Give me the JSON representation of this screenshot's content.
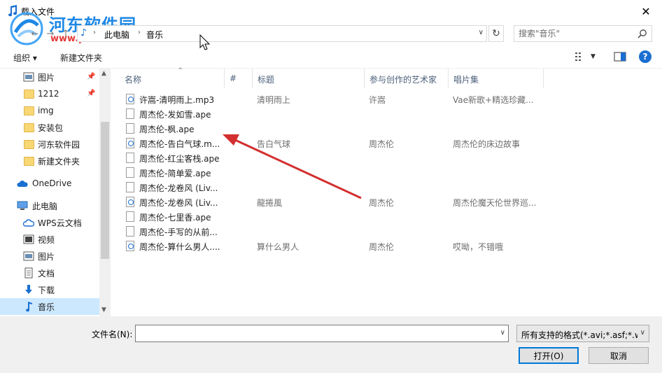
{
  "window": {
    "title": "载入文件",
    "close_glyph": "✕"
  },
  "watermark": {
    "name": "河东软件园",
    "url": "www.pc0359.cn"
  },
  "address": {
    "path": [
      "此电脑",
      "音乐"
    ]
  },
  "search": {
    "placeholder": "搜索\"音乐\""
  },
  "toolbar": {
    "organize_label": "组织 ▾",
    "new_folder_label": "新建文件夹"
  },
  "sidebar": {
    "items": [
      {
        "label": "图片",
        "icon": "pictures-icon",
        "pinned": true
      },
      {
        "label": "1212",
        "icon": "folder-icon",
        "pinned": true
      },
      {
        "label": "img",
        "icon": "folder-icon"
      },
      {
        "label": "安装包",
        "icon": "folder-icon"
      },
      {
        "label": "河东软件园",
        "icon": "folder-icon"
      },
      {
        "label": "新建文件夹",
        "icon": "folder-icon"
      },
      {
        "label": "OneDrive",
        "icon": "cloud-icon"
      },
      {
        "label": "此电脑",
        "icon": "computer-icon"
      },
      {
        "label": "WPS云文档",
        "icon": "cloud-icon"
      },
      {
        "label": "视频",
        "icon": "video-icon"
      },
      {
        "label": "图片",
        "icon": "pictures-icon"
      },
      {
        "label": "文档",
        "icon": "documents-icon"
      },
      {
        "label": "下载",
        "icon": "download-icon"
      },
      {
        "label": "音乐",
        "icon": "music-icon",
        "selected": true
      }
    ]
  },
  "columns": {
    "name": "名称",
    "number": "#",
    "title": "标题",
    "artist": "参与创作的艺术家",
    "album": "唱片集"
  },
  "files": [
    {
      "name": "许嵩-清明雨上.mp3",
      "title": "清明雨上",
      "artist": "许嵩",
      "album": "Vae新歌+精选珍藏...",
      "audio": true
    },
    {
      "name": "周杰伦-发如雪.ape",
      "title": "",
      "artist": "",
      "album": "",
      "audio": false
    },
    {
      "name": "周杰伦-枫.ape",
      "title": "",
      "artist": "",
      "album": "",
      "audio": false
    },
    {
      "name": "周杰伦-告白气球.m...",
      "title": "告白气球",
      "artist": "周杰伦",
      "album": "周杰伦的床边故事",
      "audio": true
    },
    {
      "name": "周杰伦-红尘客栈.ape",
      "title": "",
      "artist": "",
      "album": "",
      "audio": false
    },
    {
      "name": "周杰伦-简单爱.ape",
      "title": "",
      "artist": "",
      "album": "",
      "audio": false
    },
    {
      "name": "周杰伦-龙卷风 (Liv...",
      "title": "",
      "artist": "",
      "album": "",
      "audio": false
    },
    {
      "name": "周杰伦-龙卷风 (Liv...",
      "title": "龍捲風",
      "artist": "周杰伦",
      "album": "周杰伦魔天伦世界巡...",
      "audio": true
    },
    {
      "name": "周杰伦-七里香.ape",
      "title": "",
      "artist": "",
      "album": "",
      "audio": false
    },
    {
      "name": "周杰伦-手写的从前...",
      "title": "",
      "artist": "",
      "album": "",
      "audio": false
    },
    {
      "name": "周杰伦-算什么男人....",
      "title": "算什么男人",
      "artist": "周杰伦",
      "album": "哎呦，不错哦",
      "audio": true
    }
  ],
  "bottom": {
    "filename_label": "文件名(N):",
    "filename_value": "",
    "filetype_value": "所有支持的格式(*.avi;*.asf;*.wr",
    "open_label": "打开(O)",
    "cancel_label": "取消"
  },
  "colors": {
    "accent": "#0078d7",
    "selection": "#cce8ff",
    "annotation_arrow": "#d32f2f"
  }
}
